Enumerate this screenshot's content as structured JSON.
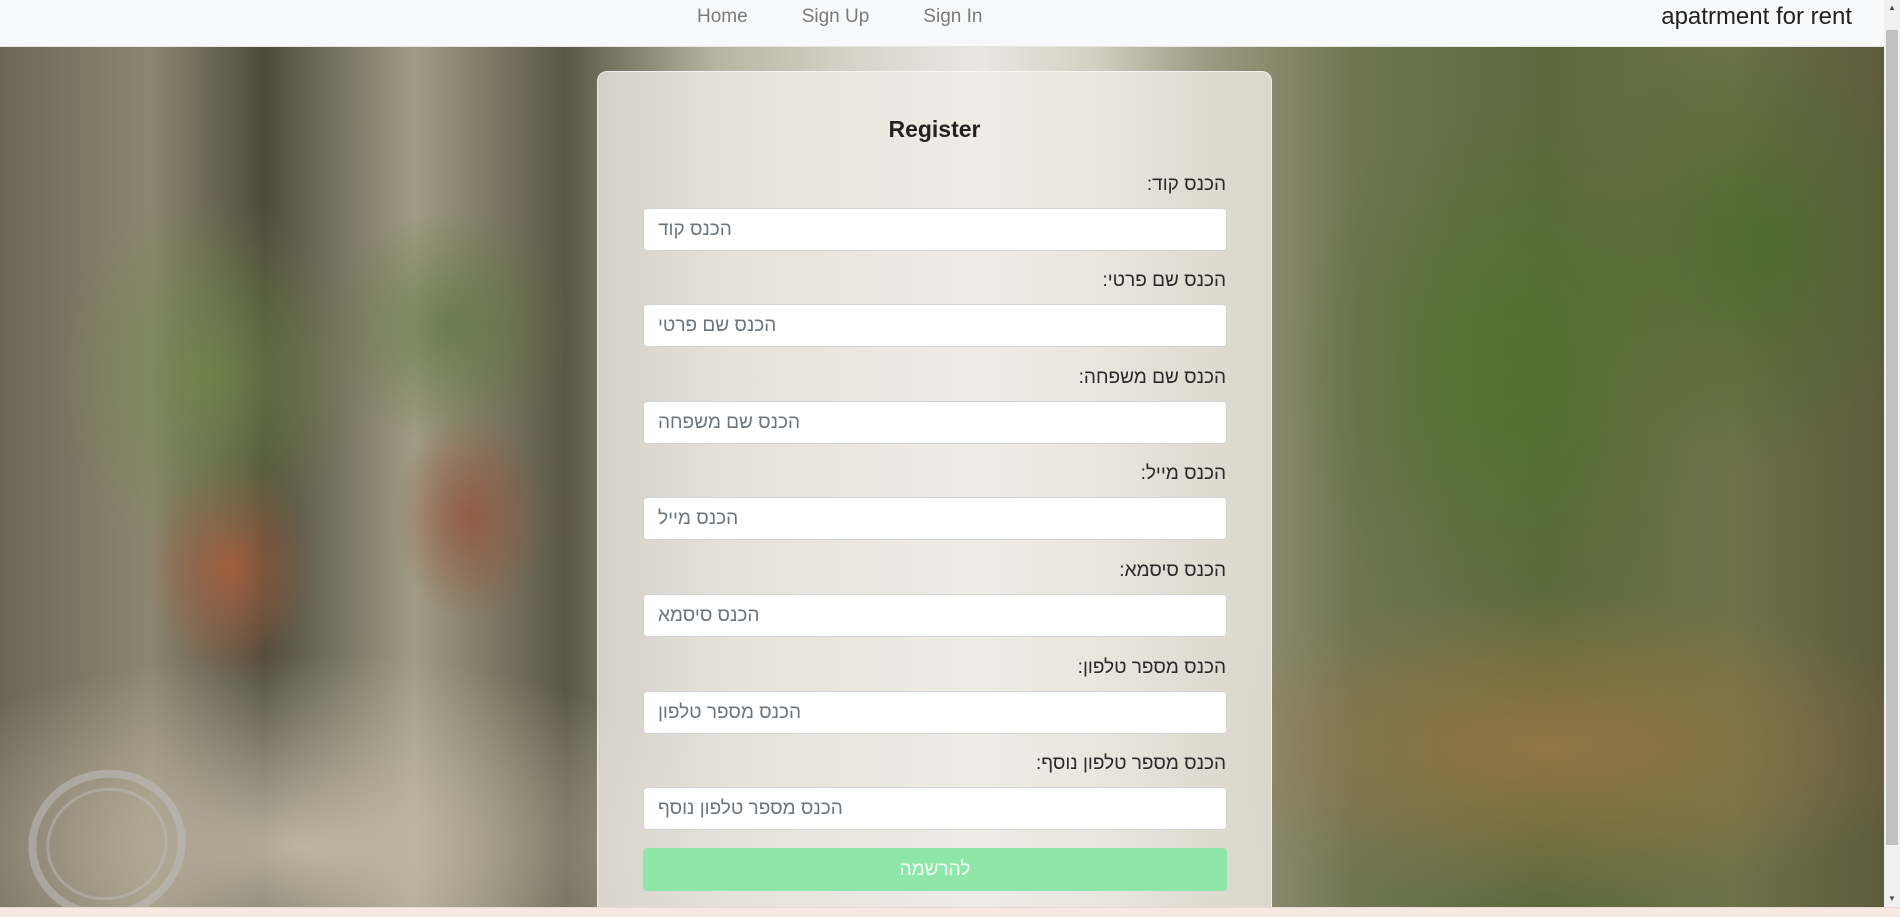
{
  "navbar": {
    "brand": "apatrment for rent",
    "links": [
      "Home",
      "Sign Up",
      "Sign In"
    ]
  },
  "form": {
    "title": "Register",
    "fields": [
      {
        "label": "הכנס קוד:",
        "placeholder": "הכנס קוד"
      },
      {
        "label": "הכנס שם פרטי:",
        "placeholder": "הכנס שם פרטי"
      },
      {
        "label": "הכנס שם משפחה:",
        "placeholder": "הכנס שם משפחה"
      },
      {
        "label": "הכנס מייל:",
        "placeholder": "הכנס מייל"
      },
      {
        "label": "הכנס סיסמא:",
        "placeholder": "הכנס סיסמא"
      },
      {
        "label": "הכנס מספר טלפון:",
        "placeholder": "הכנס מספר טלפון"
      },
      {
        "label": "הכנס מספר טלפון נוסף:",
        "placeholder": "הכנס מספר טלפון נוסף"
      }
    ],
    "submit_label": "להרשמה"
  },
  "colors": {
    "submit_button": "#8ee6a8",
    "navbar_background": "#f8f9fa"
  }
}
